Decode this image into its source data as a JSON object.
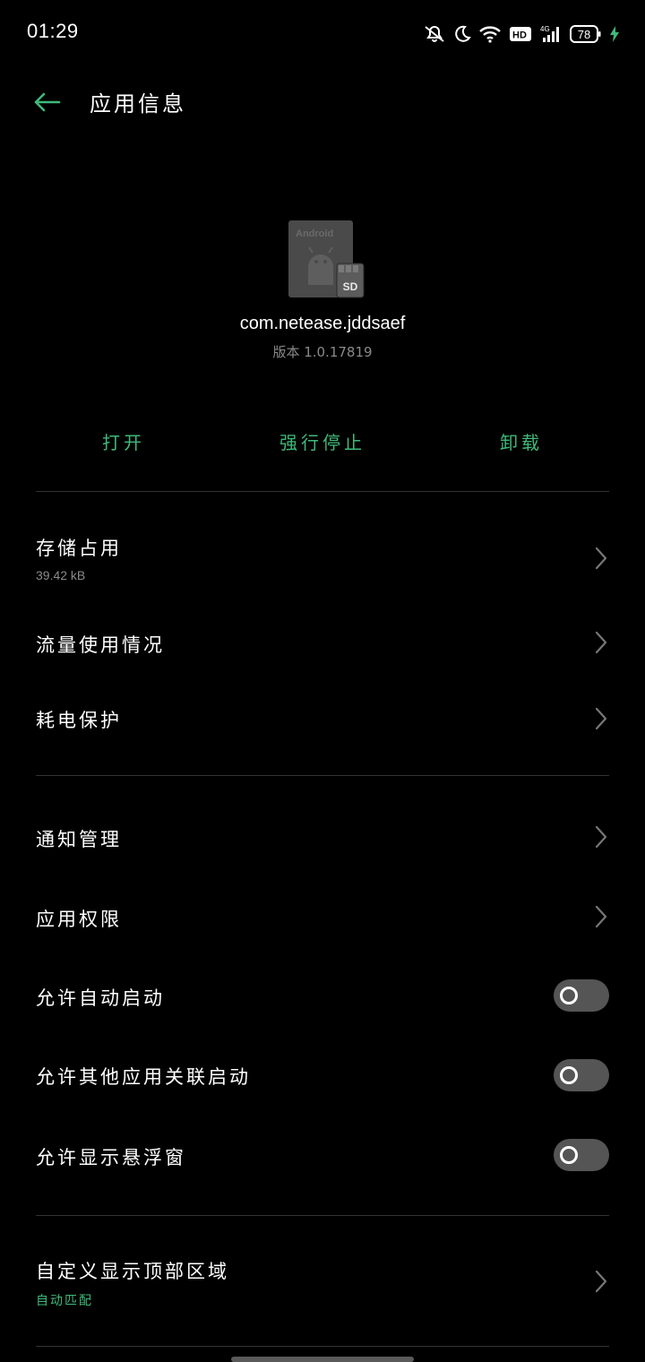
{
  "status_bar": {
    "time": "01:29",
    "hd_badge": "HD",
    "network": "4G",
    "battery": "78",
    "icons": [
      "mute-icon",
      "moon-icon",
      "wifi-icon",
      "hd-icon",
      "signal-icon",
      "battery-icon",
      "charging-icon"
    ]
  },
  "header": {
    "title": "应用信息",
    "back_icon": "back-arrow-icon"
  },
  "app": {
    "icon_label": "Android",
    "icon_badge": "SD",
    "package": "com.netease.jddsaef",
    "version": "版本 1.0.17819"
  },
  "actions": {
    "open": "打开",
    "force_stop": "强行停止",
    "uninstall": "卸载"
  },
  "sections": {
    "storage": {
      "title": "存储占用",
      "value": "39.42 kB"
    },
    "traffic": {
      "title": "流量使用情况"
    },
    "battery_protect": {
      "title": "耗电保护"
    },
    "notifications": {
      "title": "通知管理"
    },
    "permissions": {
      "title": "应用权限"
    },
    "auto_start": {
      "title": "允许自动启动",
      "enabled": false
    },
    "associated_start": {
      "title": "允许其他应用关联启动",
      "enabled": false
    },
    "floating_window": {
      "title": "允许显示悬浮窗",
      "enabled": false
    },
    "top_area": {
      "title": "自定义显示顶部区域",
      "value": "自动匹配"
    }
  },
  "colors": {
    "accent": "#3fb97a",
    "background": "#000000",
    "divider": "#333333",
    "toggle_off": "#555555"
  }
}
